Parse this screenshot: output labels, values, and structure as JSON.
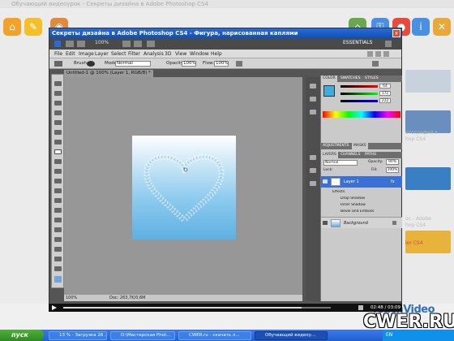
{
  "browser": {
    "title": "Обучающий видеоурок - Секреты дизайна в Adobe Photoshop CS4"
  },
  "sidebar_right": {
    "texts": [
      "отографий в",
      "hop CS4",
      "ос - Adobe",
      "hop CS4",
      "lor CS4"
    ]
  },
  "photoshop": {
    "title": "Секреты дизайна в Adobe Photoshop CS4 - Фигура, нарисованная каплями",
    "close_label": "x",
    "zoom": "100%",
    "workspace": "ESSENTIALS",
    "menu": [
      "File",
      "Edit",
      "Image",
      "Layer",
      "Select",
      "Filter",
      "Analysis",
      "3D",
      "View",
      "Window",
      "Help"
    ],
    "options": {
      "brush_label": "Brush:",
      "mode_label": "Mode:",
      "mode_value": "Normal",
      "opacity_label": "Opacity:",
      "opacity_value": "100%",
      "flow_label": "Flow:",
      "flow_value": "100%"
    },
    "document_tab": "Untitled-1 @ 100% (Layer 1, RGB/8) *",
    "status": {
      "zoom": "100%",
      "doc": "Doc: 263,7K/0,6M"
    },
    "color_panel": {
      "tabs": [
        "COLOR",
        "SWATCHES",
        "STYLES"
      ],
      "values": [
        "64",
        "172",
        "222"
      ]
    },
    "adjust_panel": {
      "tabs": [
        "ADJUSTMENTS",
        "MASKS"
      ]
    },
    "layers_panel": {
      "tabs": [
        "LAYERS",
        "CHANNELS",
        "PATHS"
      ],
      "blend": "Normal",
      "opacity_label": "Opacity:",
      "opacity_value": "90%",
      "lock_label": "Lock:",
      "fill_label": "Fill:",
      "fill_value": "100%",
      "layer1": "Layer 1",
      "effects": "Effects",
      "fx1": "Drop Shadow",
      "fx2": "Inner Shadow",
      "fx3": "Bevel and Emboss",
      "background": "Background"
    },
    "watermark": "TeachVideo",
    "accent": "#2c6fc4"
  },
  "player": {
    "time": "02:48 / 03:09",
    "progress": 0.89
  },
  "taskbar": {
    "start": "пуск",
    "tasks": [
      "13 % - Загрузка 26 ...",
      "D:\\Мастерская Phot...",
      "CWER.ru - скачать л...",
      "Обучающий видеоу..."
    ],
    "lang": "EN"
  },
  "overlay_logo": "CWER.RU"
}
